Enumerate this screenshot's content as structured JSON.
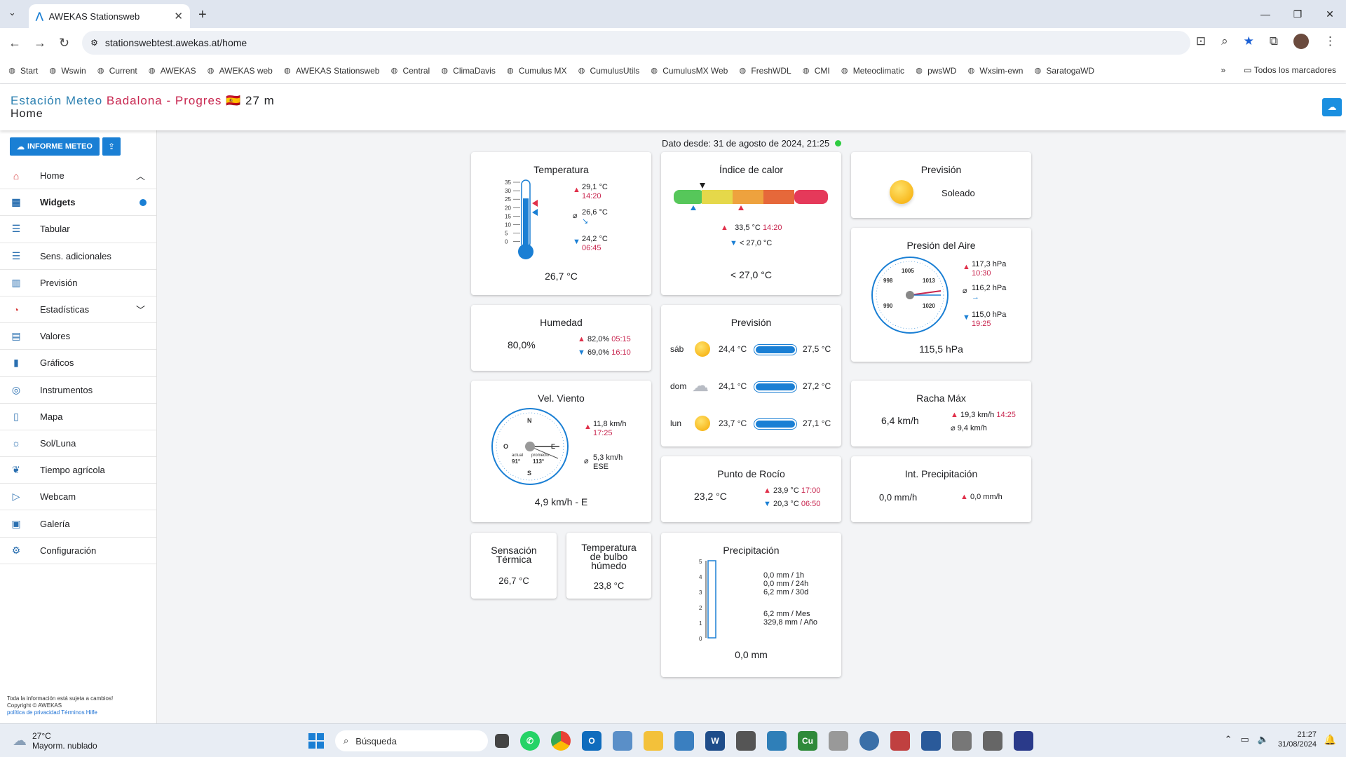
{
  "browser": {
    "tab_title": "AWEKAS Stationsweb",
    "url": "stationswebtest.awekas.at/home",
    "bookmarks": [
      "Start",
      "Wswin",
      "Current",
      "AWEKAS",
      "AWEKAS web",
      "AWEKAS Stationsweb",
      "Central",
      "ClimaDavis",
      "Cumulus MX",
      "CumulusUtils",
      "CumulusMX Web",
      "FreshWDL",
      "CMI",
      "Meteoclimatic",
      "pwsWD",
      "Wxsim-ewn",
      "SaratogaWD"
    ],
    "all_bookmarks": "Todos los marcadores",
    "more": "»"
  },
  "header": {
    "title_part1": "Estación Meteo",
    "title_part2": "Badalona - Progres",
    "flag": "🇪🇸",
    "altitude": "27 m",
    "page": "Home"
  },
  "sidebar": {
    "informe_label": "INFORME METEO",
    "items": [
      {
        "label": "Home",
        "icon": "home-icon"
      },
      {
        "label": "Widgets",
        "icon": "widgets-icon"
      },
      {
        "label": "Tabular",
        "icon": "list-icon"
      },
      {
        "label": "Sens. adicionales",
        "icon": "list-icon"
      },
      {
        "label": "Previsión",
        "icon": "chart-icon"
      },
      {
        "label": "Estadísticas",
        "icon": "stats-icon"
      },
      {
        "label": "Valores",
        "icon": "document-icon"
      },
      {
        "label": "Gráficos",
        "icon": "bar-chart-icon"
      },
      {
        "label": "Instrumentos",
        "icon": "gauge-icon"
      },
      {
        "label": "Mapa",
        "icon": "map-icon"
      },
      {
        "label": "Sol/Luna",
        "icon": "sun-icon"
      },
      {
        "label": "Tiempo agrícola",
        "icon": "leaf-icon"
      },
      {
        "label": "Webcam",
        "icon": "camera-icon"
      },
      {
        "label": "Galería",
        "icon": "gallery-icon"
      },
      {
        "label": "Configuración",
        "icon": "gear-icon"
      }
    ],
    "footer1": "Toda la información está sujeta a cambios!",
    "footer2": "Copyright © AWEKAS",
    "footer3": "política de privacidad Términos Hilfe"
  },
  "dato": "Dato desde: 31 de agosto de 2024, 21:25",
  "temperatura": {
    "title": "Temperatura",
    "value": "26,7 °C",
    "max": "29,1 °C",
    "max_time": "14:20",
    "avg": "26,6 °C",
    "min": "24,2 °C",
    "min_time": "06:45",
    "scale": [
      "35",
      "30",
      "25",
      "20",
      "15",
      "10",
      "5",
      "0"
    ],
    "fill_fraction": 0.76
  },
  "calor": {
    "title": "Índice de calor",
    "max": "33,5 °C",
    "max_time": "14:20",
    "min": "< 27,0 °C",
    "value": "< 27,0 °C"
  },
  "prevision_top": {
    "title": "Previsión",
    "desc": "Soleado"
  },
  "presion": {
    "title": "Presión del Aire",
    "value": "115,5 hPa",
    "max": "117,3 hPa",
    "max_time": "10:30",
    "avg": "116,2 hPa",
    "min": "115,0 hPa",
    "min_time": "19:25",
    "labels": [
      "1005",
      "998",
      "1013",
      "990",
      "1020"
    ]
  },
  "humedad": {
    "title": "Humedad",
    "value": "80,0%",
    "max": "82,0%",
    "max_time": "05:15",
    "min": "69,0%",
    "min_time": "16:10"
  },
  "prevision": {
    "title": "Previsión",
    "days": [
      {
        "day": "sáb",
        "min": "24,4 °C",
        "max": "27,5 °C",
        "icon": "sun-icon"
      },
      {
        "day": "dom",
        "min": "24,1 °C",
        "max": "27,2 °C",
        "icon": "cloud-rain-icon"
      },
      {
        "day": "lun",
        "min": "23,7 °C",
        "max": "27,1 °C",
        "icon": "sun-icon"
      }
    ]
  },
  "viento": {
    "title": "Vel. Viento",
    "value": "4,9 km/h - E",
    "max": "11,8 km/h",
    "max_time": "17:25",
    "avg": "5,3 km/h",
    "avg_dir": "ESE",
    "compass": [
      "N",
      "E",
      "S",
      "O"
    ],
    "actual": "actual",
    "promedio": "promedio",
    "deg1": "91°",
    "deg2": "113°"
  },
  "racha": {
    "title": "Racha Máx",
    "value": "6,4 km/h",
    "max": "19,3 km/h",
    "max_time": "14:25",
    "avg": "9,4 km/h"
  },
  "rocio": {
    "title": "Punto de Rocío",
    "value": "23,2 °C",
    "max": "23,9 °C",
    "max_time": "17:00",
    "min": "20,3 °C",
    "min_time": "06:50"
  },
  "intprec": {
    "title": "Int. Precipitación",
    "value": "0,0 mm/h",
    "max": "0,0 mm/h"
  },
  "sensacion": {
    "title": "Sensación Térmica",
    "value": "26,7 °C"
  },
  "bulbo": {
    "title": "Temperatura de bulbo húmedo",
    "value": "23,8 °C"
  },
  "precip": {
    "title": "Precipitación",
    "value": "0,0 mm",
    "h1": "0,0 mm / 1h",
    "h24": "0,0 mm / 24h",
    "d30": "6,2 mm / 30d",
    "mes": "6,2 mm / Mes",
    "ano": "329,8 mm / Año",
    "scale": [
      "5",
      "4",
      "3",
      "2",
      "1",
      "0"
    ]
  },
  "taskbar": {
    "temp": "27°C",
    "weather": "Mayorm. nublado",
    "search": "Búsqueda",
    "time": "21:27",
    "date": "31/08/2024"
  }
}
